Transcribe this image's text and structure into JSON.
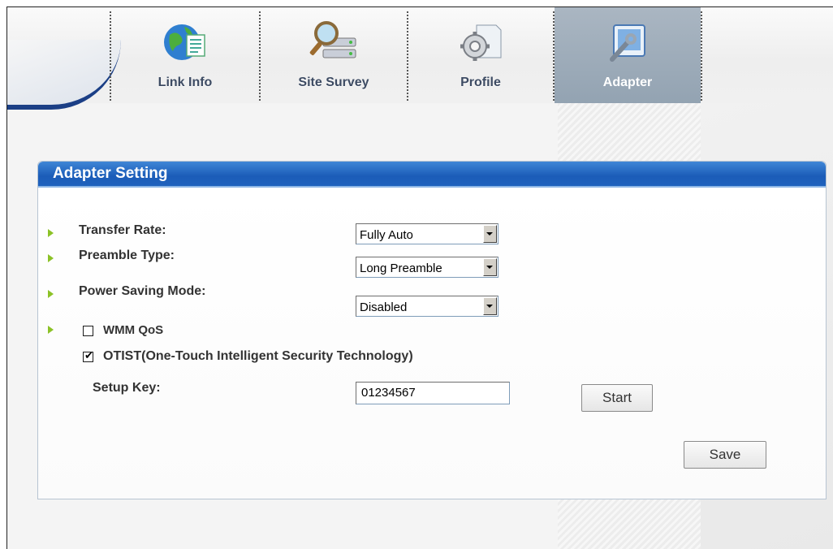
{
  "toolbar": {
    "tabs": [
      {
        "label": "Link Info",
        "icon": "globe-document-icon",
        "active": false
      },
      {
        "label": "Site Survey",
        "icon": "magnifier-network-icon",
        "active": false
      },
      {
        "label": "Profile",
        "icon": "gear-page-icon",
        "active": false
      },
      {
        "label": "Adapter",
        "icon": "wrench-screen-icon",
        "active": true
      }
    ]
  },
  "panel": {
    "title": "Adapter Setting",
    "transfer_rate": {
      "label": "Transfer Rate:",
      "value": "Fully Auto"
    },
    "preamble_type": {
      "label": "Preamble Type:",
      "value": "Long Preamble"
    },
    "power_saving": {
      "label": "Power Saving Mode:",
      "value": "Disabled"
    },
    "wmm_qos": {
      "label": "WMM QoS",
      "checked": false
    },
    "otist": {
      "label": "OTIST(One-Touch Intelligent Security Technology)",
      "checked": true
    },
    "setup_key": {
      "label": "Setup Key:",
      "value": "01234567"
    },
    "start_label": "Start",
    "save_label": "Save"
  },
  "colors": {
    "header_blue": "#1b5cb8",
    "active_tab": "#93a3b2",
    "arrow_green": "#8cc227"
  }
}
